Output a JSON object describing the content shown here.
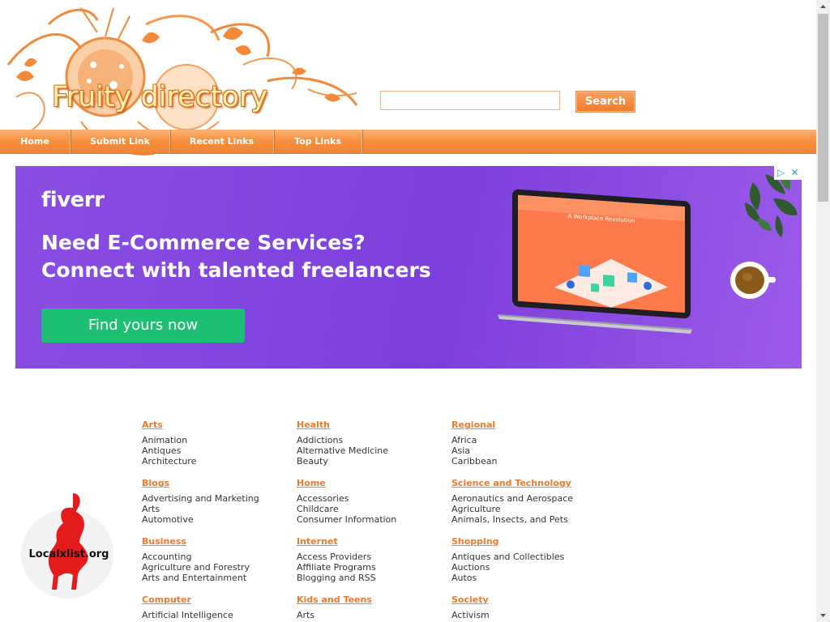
{
  "header": {
    "site_title": "Fruity directory",
    "search": {
      "value": "",
      "placeholder": "",
      "button_label": "Search"
    }
  },
  "nav": {
    "items": [
      {
        "label": "Home"
      },
      {
        "label": "Submit Link"
      },
      {
        "label": "Recent Links"
      },
      {
        "label": "Top Links"
      }
    ]
  },
  "ad": {
    "brand": "fiverr",
    "headline_line1": "Need E-Commerce Services?",
    "headline_line2": "Connect with talented freelancers",
    "cta_label": "Find yours now",
    "screen_caption": "A Workplace Revolution",
    "background_color": "#8a4ee3",
    "cta_color": "#1dbf73"
  },
  "badge": {
    "text": "Localxlist.org"
  },
  "categories": [
    {
      "title": "Arts",
      "subs": [
        "Animation",
        "Antiques",
        "Architecture"
      ]
    },
    {
      "title": "Health",
      "subs": [
        "Addictions",
        "Alternative Medicine",
        "Beauty"
      ]
    },
    {
      "title": "Regional",
      "subs": [
        "Africa",
        "Asia",
        "Caribbean"
      ]
    },
    {
      "title": "Blogs",
      "subs": [
        "Advertising and Marketing",
        "Arts",
        "Automotive"
      ]
    },
    {
      "title": "Home",
      "subs": [
        "Accessories",
        "Childcare",
        "Consumer Information"
      ]
    },
    {
      "title": "Science and Technology",
      "subs": [
        "Aeronautics and Aerospace",
        "Agriculture",
        "Animals, Insects, and Pets"
      ]
    },
    {
      "title": "Business",
      "subs": [
        "Accounting",
        "Agriculture and Forestry",
        "Arts and Entertainment"
      ]
    },
    {
      "title": "Internet",
      "subs": [
        "Access Providers",
        "Affiliate Programs",
        "Blogging and RSS"
      ]
    },
    {
      "title": "Shopping",
      "subs": [
        "Antiques and Collectibles",
        "Auctions",
        "Autos"
      ]
    },
    {
      "title": "Computer",
      "subs": [
        "Artificial Intelligence"
      ]
    },
    {
      "title": "Kids and Teens",
      "subs": [
        "Arts"
      ]
    },
    {
      "title": "Society",
      "subs": [
        "Activism"
      ]
    }
  ],
  "colors": {
    "accent": "#f07a2c",
    "nav_top": "#fbb57a",
    "nav_bottom": "#f08434"
  }
}
